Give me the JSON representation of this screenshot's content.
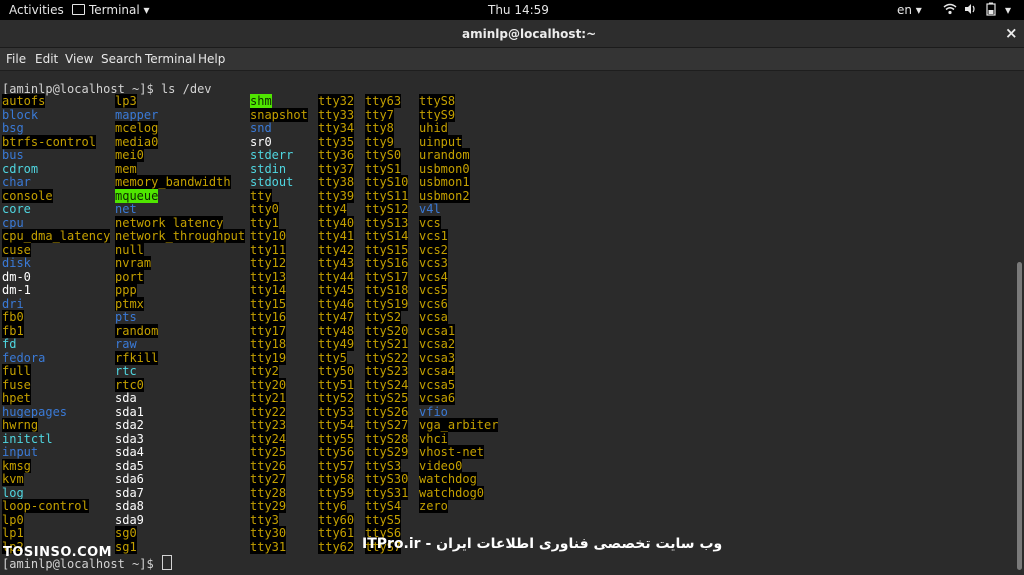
{
  "topbar": {
    "activities": "Activities",
    "app": "Terminal ▾",
    "clock": "Thu 14:59",
    "lang": "en ▾"
  },
  "titlebar": {
    "title": "aminlp@localhost:~",
    "close": "×"
  },
  "menu": [
    "File",
    "Edit",
    "View",
    "Search",
    "Terminal",
    "Help"
  ],
  "prompt1": "[aminlp@localhost ~]$ ls /dev",
  "prompt2": "[aminlp@localhost ~]$ ",
  "columns": [
    [
      {
        "t": "autofs",
        "s": "y"
      },
      {
        "t": "block",
        "s": "b"
      },
      {
        "t": "bsg",
        "s": "b"
      },
      {
        "t": "btrfs-control",
        "s": "y"
      },
      {
        "t": "bus",
        "s": "b"
      },
      {
        "t": "cdrom",
        "s": "c"
      },
      {
        "t": "char",
        "s": "b"
      },
      {
        "t": "console",
        "s": "y"
      },
      {
        "t": "core",
        "s": "c"
      },
      {
        "t": "cpu",
        "s": "b"
      },
      {
        "t": "cpu_dma_latency",
        "s": "y"
      },
      {
        "t": "cuse",
        "s": "y"
      },
      {
        "t": "disk",
        "s": "b"
      },
      {
        "t": "dm-0",
        "s": "w"
      },
      {
        "t": "dm-1",
        "s": "w"
      },
      {
        "t": "dri",
        "s": "b"
      },
      {
        "t": "fb0",
        "s": "y"
      },
      {
        "t": "fb1",
        "s": "y"
      },
      {
        "t": "fd",
        "s": "c"
      },
      {
        "t": "fedora",
        "s": "b"
      },
      {
        "t": "full",
        "s": "y"
      },
      {
        "t": "fuse",
        "s": "y"
      },
      {
        "t": "hpet",
        "s": "y"
      },
      {
        "t": "hugepages",
        "s": "b"
      },
      {
        "t": "hwrng",
        "s": "y"
      },
      {
        "t": "initctl",
        "s": "c"
      },
      {
        "t": "input",
        "s": "b"
      },
      {
        "t": "kmsg",
        "s": "y"
      },
      {
        "t": "kvm",
        "s": "y"
      },
      {
        "t": "log",
        "s": "c"
      },
      {
        "t": "loop-control",
        "s": "y"
      },
      {
        "t": "lp0",
        "s": "y"
      },
      {
        "t": "lp1",
        "s": "y"
      },
      {
        "t": "lp2",
        "s": "y"
      }
    ],
    [
      {
        "t": "lp3",
        "s": "y"
      },
      {
        "t": "mapper",
        "s": "b"
      },
      {
        "t": "mcelog",
        "s": "y"
      },
      {
        "t": "media0",
        "s": "y"
      },
      {
        "t": "mei0",
        "s": "y"
      },
      {
        "t": "mem",
        "s": "y"
      },
      {
        "t": "memory_bandwidth",
        "s": "y"
      },
      {
        "t": "mqueue",
        "s": "g"
      },
      {
        "t": "net",
        "s": "b"
      },
      {
        "t": "network_latency",
        "s": "y"
      },
      {
        "t": "network_throughput",
        "s": "y"
      },
      {
        "t": "null",
        "s": "y"
      },
      {
        "t": "nvram",
        "s": "y"
      },
      {
        "t": "port",
        "s": "y"
      },
      {
        "t": "ppp",
        "s": "y"
      },
      {
        "t": "ptmx",
        "s": "y"
      },
      {
        "t": "pts",
        "s": "b"
      },
      {
        "t": "random",
        "s": "y"
      },
      {
        "t": "raw",
        "s": "b"
      },
      {
        "t": "rfkill",
        "s": "y"
      },
      {
        "t": "rtc",
        "s": "c"
      },
      {
        "t": "rtc0",
        "s": "y"
      },
      {
        "t": "sda",
        "s": "w"
      },
      {
        "t": "sda1",
        "s": "w"
      },
      {
        "t": "sda2",
        "s": "w"
      },
      {
        "t": "sda3",
        "s": "w"
      },
      {
        "t": "sda4",
        "s": "w"
      },
      {
        "t": "sda5",
        "s": "w"
      },
      {
        "t": "sda6",
        "s": "w"
      },
      {
        "t": "sda7",
        "s": "w"
      },
      {
        "t": "sda8",
        "s": "w"
      },
      {
        "t": "sda9",
        "s": "w"
      },
      {
        "t": "sg0",
        "s": "y"
      },
      {
        "t": "sg1",
        "s": "y"
      }
    ],
    [
      {
        "t": "shm",
        "s": "g"
      },
      {
        "t": "snapshot",
        "s": "y"
      },
      {
        "t": "snd",
        "s": "b"
      },
      {
        "t": "sr0",
        "s": "w"
      },
      {
        "t": "stderr",
        "s": "c"
      },
      {
        "t": "stdin",
        "s": "c"
      },
      {
        "t": "stdout",
        "s": "c"
      },
      {
        "t": "tty",
        "s": "y"
      },
      {
        "t": "tty0",
        "s": "y"
      },
      {
        "t": "tty1",
        "s": "y"
      },
      {
        "t": "tty10",
        "s": "y"
      },
      {
        "t": "tty11",
        "s": "y"
      },
      {
        "t": "tty12",
        "s": "y"
      },
      {
        "t": "tty13",
        "s": "y"
      },
      {
        "t": "tty14",
        "s": "y"
      },
      {
        "t": "tty15",
        "s": "y"
      },
      {
        "t": "tty16",
        "s": "y"
      },
      {
        "t": "tty17",
        "s": "y"
      },
      {
        "t": "tty18",
        "s": "y"
      },
      {
        "t": "tty19",
        "s": "y"
      },
      {
        "t": "tty2",
        "s": "y"
      },
      {
        "t": "tty20",
        "s": "y"
      },
      {
        "t": "tty21",
        "s": "y"
      },
      {
        "t": "tty22",
        "s": "y"
      },
      {
        "t": "tty23",
        "s": "y"
      },
      {
        "t": "tty24",
        "s": "y"
      },
      {
        "t": "tty25",
        "s": "y"
      },
      {
        "t": "tty26",
        "s": "y"
      },
      {
        "t": "tty27",
        "s": "y"
      },
      {
        "t": "tty28",
        "s": "y"
      },
      {
        "t": "tty29",
        "s": "y"
      },
      {
        "t": "tty3",
        "s": "y"
      },
      {
        "t": "tty30",
        "s": "y"
      },
      {
        "t": "tty31",
        "s": "y"
      }
    ],
    [
      {
        "t": "tty32",
        "s": "y"
      },
      {
        "t": "tty33",
        "s": "y"
      },
      {
        "t": "tty34",
        "s": "y"
      },
      {
        "t": "tty35",
        "s": "y"
      },
      {
        "t": "tty36",
        "s": "y"
      },
      {
        "t": "tty37",
        "s": "y"
      },
      {
        "t": "tty38",
        "s": "y"
      },
      {
        "t": "tty39",
        "s": "y"
      },
      {
        "t": "tty4",
        "s": "y"
      },
      {
        "t": "tty40",
        "s": "y"
      },
      {
        "t": "tty41",
        "s": "y"
      },
      {
        "t": "tty42",
        "s": "y"
      },
      {
        "t": "tty43",
        "s": "y"
      },
      {
        "t": "tty44",
        "s": "y"
      },
      {
        "t": "tty45",
        "s": "y"
      },
      {
        "t": "tty46",
        "s": "y"
      },
      {
        "t": "tty47",
        "s": "y"
      },
      {
        "t": "tty48",
        "s": "y"
      },
      {
        "t": "tty49",
        "s": "y"
      },
      {
        "t": "tty5",
        "s": "y"
      },
      {
        "t": "tty50",
        "s": "y"
      },
      {
        "t": "tty51",
        "s": "y"
      },
      {
        "t": "tty52",
        "s": "y"
      },
      {
        "t": "tty53",
        "s": "y"
      },
      {
        "t": "tty54",
        "s": "y"
      },
      {
        "t": "tty55",
        "s": "y"
      },
      {
        "t": "tty56",
        "s": "y"
      },
      {
        "t": "tty57",
        "s": "y"
      },
      {
        "t": "tty58",
        "s": "y"
      },
      {
        "t": "tty59",
        "s": "y"
      },
      {
        "t": "tty6",
        "s": "y"
      },
      {
        "t": "tty60",
        "s": "y"
      },
      {
        "t": "tty61",
        "s": "y"
      },
      {
        "t": "tty62",
        "s": "y"
      }
    ],
    [
      {
        "t": "tty63",
        "s": "y"
      },
      {
        "t": "tty7",
        "s": "y"
      },
      {
        "t": "tty8",
        "s": "y"
      },
      {
        "t": "tty9",
        "s": "y"
      },
      {
        "t": "ttyS0",
        "s": "y"
      },
      {
        "t": "ttyS1",
        "s": "y"
      },
      {
        "t": "ttyS10",
        "s": "y"
      },
      {
        "t": "ttyS11",
        "s": "y"
      },
      {
        "t": "ttyS12",
        "s": "y"
      },
      {
        "t": "ttyS13",
        "s": "y"
      },
      {
        "t": "ttyS14",
        "s": "y"
      },
      {
        "t": "ttyS15",
        "s": "y"
      },
      {
        "t": "ttyS16",
        "s": "y"
      },
      {
        "t": "ttyS17",
        "s": "y"
      },
      {
        "t": "ttyS18",
        "s": "y"
      },
      {
        "t": "ttyS19",
        "s": "y"
      },
      {
        "t": "ttyS2",
        "s": "y"
      },
      {
        "t": "ttyS20",
        "s": "y"
      },
      {
        "t": "ttyS21",
        "s": "y"
      },
      {
        "t": "ttyS22",
        "s": "y"
      },
      {
        "t": "ttyS23",
        "s": "y"
      },
      {
        "t": "ttyS24",
        "s": "y"
      },
      {
        "t": "ttyS25",
        "s": "y"
      },
      {
        "t": "ttyS26",
        "s": "y"
      },
      {
        "t": "ttyS27",
        "s": "y"
      },
      {
        "t": "ttyS28",
        "s": "y"
      },
      {
        "t": "ttyS29",
        "s": "y"
      },
      {
        "t": "ttyS3",
        "s": "y"
      },
      {
        "t": "ttyS30",
        "s": "y"
      },
      {
        "t": "ttyS31",
        "s": "y"
      },
      {
        "t": "ttyS4",
        "s": "y"
      },
      {
        "t": "ttyS5",
        "s": "y"
      },
      {
        "t": "ttyS6",
        "s": "y"
      },
      {
        "t": "ttyS7",
        "s": "y"
      }
    ],
    [
      {
        "t": "ttyS8",
        "s": "y"
      },
      {
        "t": "ttyS9",
        "s": "y"
      },
      {
        "t": "uhid",
        "s": "y"
      },
      {
        "t": "uinput",
        "s": "y"
      },
      {
        "t": "urandom",
        "s": "y"
      },
      {
        "t": "usbmon0",
        "s": "y"
      },
      {
        "t": "usbmon1",
        "s": "y"
      },
      {
        "t": "usbmon2",
        "s": "y"
      },
      {
        "t": "v4l",
        "s": "b"
      },
      {
        "t": "vcs",
        "s": "y"
      },
      {
        "t": "vcs1",
        "s": "y"
      },
      {
        "t": "vcs2",
        "s": "y"
      },
      {
        "t": "vcs3",
        "s": "y"
      },
      {
        "t": "vcs4",
        "s": "y"
      },
      {
        "t": "vcs5",
        "s": "y"
      },
      {
        "t": "vcs6",
        "s": "y"
      },
      {
        "t": "vcsa",
        "s": "y"
      },
      {
        "t": "vcsa1",
        "s": "y"
      },
      {
        "t": "vcsa2",
        "s": "y"
      },
      {
        "t": "vcsa3",
        "s": "y"
      },
      {
        "t": "vcsa4",
        "s": "y"
      },
      {
        "t": "vcsa5",
        "s": "y"
      },
      {
        "t": "vcsa6",
        "s": "y"
      },
      {
        "t": "vfio",
        "s": "b"
      },
      {
        "t": "vga_arbiter",
        "s": "y"
      },
      {
        "t": "vhci",
        "s": "y"
      },
      {
        "t": "vhost-net",
        "s": "y"
      },
      {
        "t": "video0",
        "s": "y"
      },
      {
        "t": "watchdog",
        "s": "y"
      },
      {
        "t": "watchdog0",
        "s": "y"
      },
      {
        "t": "zero",
        "s": "y"
      }
    ]
  ],
  "watermark_left": "TOSINSO.COM",
  "watermark_right": "ITPro.ir - وب سایت تخصصی فناوری اطلاعات ایران"
}
